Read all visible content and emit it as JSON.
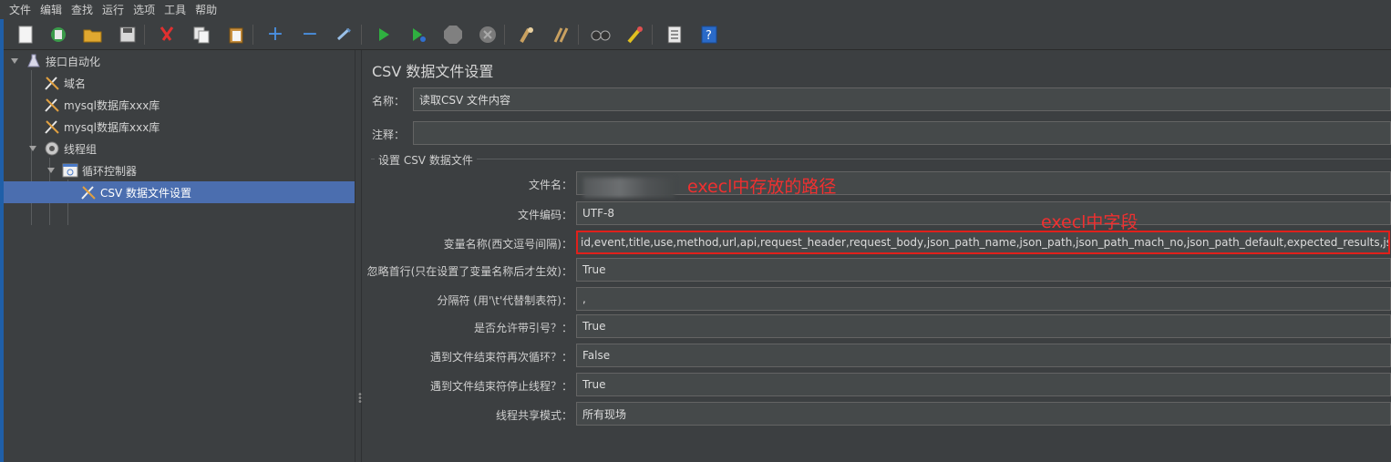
{
  "menu": [
    "文件",
    "编辑",
    "查找",
    "运行",
    "选项",
    "工具",
    "帮助"
  ],
  "toolbar": {
    "icons": [
      "new-icon",
      "templates-icon",
      "open-icon",
      "save-icon",
      "cut-icon",
      "copy-icon",
      "paste-icon",
      "expand-icon",
      "collapse-icon",
      "toggle-icon",
      "start-icon",
      "start-no-pause-icon",
      "stop-icon",
      "shutdown-icon",
      "clear-icon",
      "clear-all-icon",
      "search-icon",
      "reset-search-icon",
      "function-helper-icon",
      "help-icon"
    ]
  },
  "tree": {
    "items": [
      {
        "label": "接口自动化",
        "icon": "test-plan-icon"
      },
      {
        "label": "域名",
        "icon": "config-element-icon"
      },
      {
        "label": "mysql数据库xxx库",
        "icon": "config-element-icon"
      },
      {
        "label": "mysql数据库xxx库",
        "icon": "config-element-icon"
      },
      {
        "label": "线程组",
        "icon": "thread-group-icon"
      },
      {
        "label": "循环控制器",
        "icon": "loop-controller-icon"
      },
      {
        "label": "CSV 数据文件设置",
        "icon": "config-element-icon"
      }
    ]
  },
  "panel": {
    "title": "CSV 数据文件设置",
    "name_label": "名称：",
    "name_value": "读取CSV 文件内容",
    "comment_label": "注释：",
    "comment_value": "",
    "group_title": "设置 CSV 数据文件",
    "fields": [
      {
        "label": "文件名：",
        "value": ""
      },
      {
        "label": "文件编码：",
        "value": "UTF-8"
      },
      {
        "label": "变量名称(西文逗号间隔)：",
        "value": "id,event,title,use,method,url,api,request_header,request_body,json_path_name,json_path,json_path_mach_no,json_path_default,expected_results,jsonpath,json"
      },
      {
        "label": "忽略首行(只在设置了变量名称后才生效)：",
        "value": "True"
      },
      {
        "label": "分隔符 (用'\\t'代替制表符)：",
        "value": ","
      },
      {
        "label": "是否允许带引号？：",
        "value": "True"
      },
      {
        "label": "遇到文件结束符再次循环？：",
        "value": "False"
      },
      {
        "label": "遇到文件结束符停止线程？：",
        "value": "True"
      },
      {
        "label": "线程共享模式：",
        "value": "所有现场"
      }
    ]
  },
  "annotations": {
    "filename_note": "execl中存放的路径",
    "fields_note": "execl中字段",
    "color": "#f03030"
  }
}
